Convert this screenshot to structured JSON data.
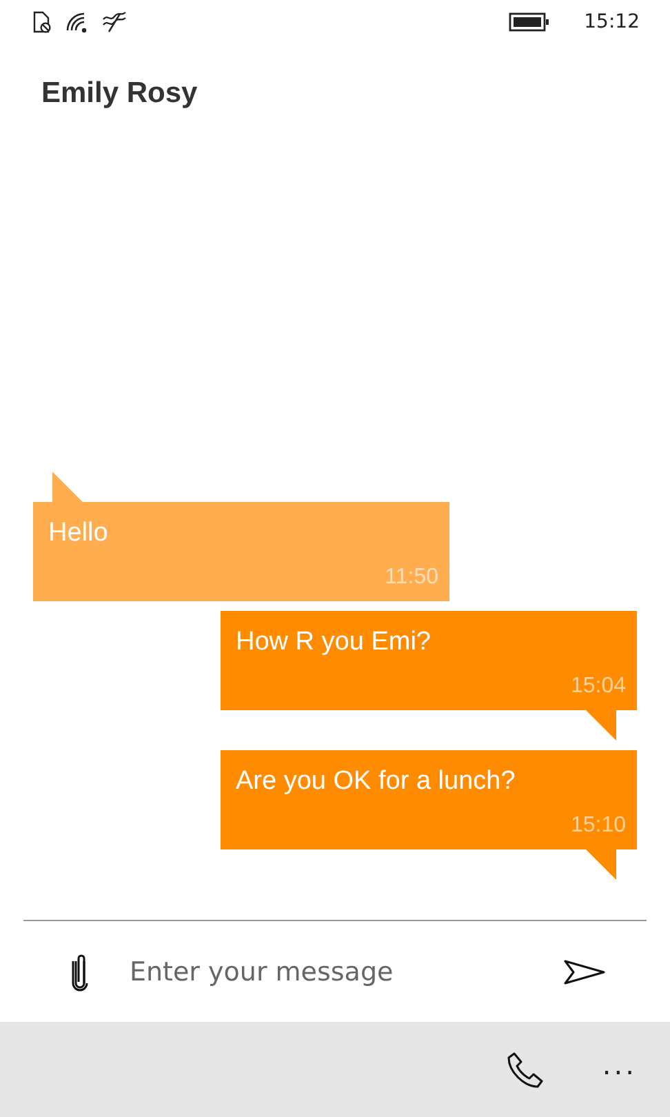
{
  "status_bar": {
    "time": "15:12"
  },
  "contact": {
    "name": "Emily Rosy"
  },
  "messages": [
    {
      "kind": "received",
      "text": "Hello",
      "time": "11:50"
    },
    {
      "kind": "sent",
      "text": "How R you Emi?",
      "time": "15:04"
    },
    {
      "kind": "sent",
      "text": "Are you OK for a lunch?",
      "time": "15:10"
    }
  ],
  "composer": {
    "placeholder": "Enter your message"
  },
  "app_bar": {
    "more": "..."
  }
}
